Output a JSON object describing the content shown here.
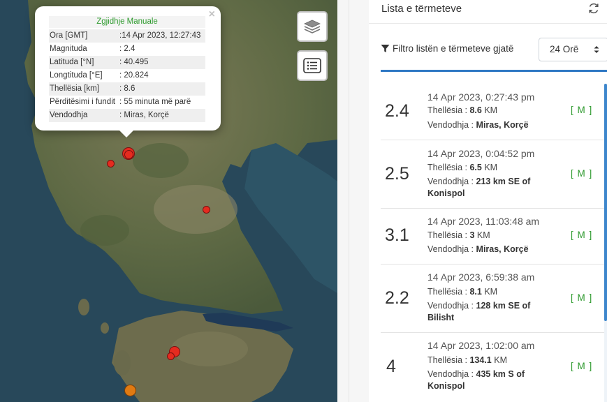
{
  "map": {
    "layers_icon": "layers-icon",
    "list_icon": "list-icon",
    "markers": [
      {
        "color": "#e52b1f"
      },
      {
        "color": "#e52b1f"
      },
      {
        "color": "#e52b1f"
      },
      {
        "color": "#e52b1f"
      },
      {
        "color": "#e52b1f"
      },
      {
        "color": "#e52b1f"
      },
      {
        "color": "#e07a12"
      }
    ],
    "popup": {
      "title": "Zgjidhje Manuale",
      "close": "×",
      "rows": [
        {
          "key": "Ora [GMT]",
          "value": ":14 Apr 2023, 12:27:43"
        },
        {
          "key": "Magnituda",
          "value": ": 2.4"
        },
        {
          "key": "Latituda [°N]",
          "value": ": 40.495"
        },
        {
          "key": "Longtituda [°E]",
          "value": ": 20.824"
        },
        {
          "key": "Thellësia [km]",
          "value": ": 8.6"
        },
        {
          "key": "Përditësimi i fundit",
          "value": ": 55 minuta më parë"
        },
        {
          "key": "Vendodhja",
          "value": ": Miras, Korçë"
        }
      ]
    }
  },
  "sidebar": {
    "title": "Lista e tërmeteve",
    "refresh_icon": "refresh-icon",
    "filter": {
      "label": "Filtro listën e tërmeteve gjatë",
      "selected": "24 Orë"
    },
    "depth_label": "Thellësia :",
    "location_label": "Vendodhja :",
    "unit": "KM",
    "tag": "[ M ]",
    "earthquakes": [
      {
        "mag": "2.4",
        "time": "14 Apr 2023, 0:27:43 pm",
        "depth": "8.6",
        "loc1": "Miras, Korçë",
        "loc2": ""
      },
      {
        "mag": "2.5",
        "time": "14 Apr 2023, 0:04:52 pm",
        "depth": "6.5",
        "loc1": "213 km SE of",
        "loc2": "Konispol"
      },
      {
        "mag": "3.1",
        "time": "14 Apr 2023, 11:03:48 am",
        "depth": "3",
        "loc1": "Miras, Korçë",
        "loc2": ""
      },
      {
        "mag": "2.2",
        "time": "14 Apr 2023, 6:59:38 am",
        "depth": "8.1",
        "loc1": "128 km SE of",
        "loc2": "Bilisht"
      },
      {
        "mag": "4",
        "time": "14 Apr 2023, 1:02:00 am",
        "depth": "134.1",
        "loc1": "435 km S of",
        "loc2": "Konispol"
      }
    ]
  }
}
